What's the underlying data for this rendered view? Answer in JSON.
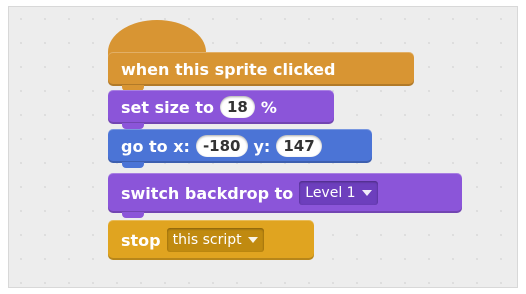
{
  "colors": {
    "events": "#d89533",
    "looks": "#8b55d9",
    "motion": "#4b74d6",
    "control": "#e0a420"
  },
  "script": {
    "hat": {
      "label": "when this sprite clicked"
    },
    "set_size": {
      "label": "set size to",
      "value": "18",
      "unit": "%"
    },
    "go_to": {
      "label": "go to x:",
      "x_value": "-180",
      "y_label": "y:",
      "y_value": "147"
    },
    "switch_backdrop": {
      "label": "switch backdrop to",
      "selected": "Level 1"
    },
    "stop": {
      "label": "stop",
      "selected": "this script"
    }
  },
  "icons": {
    "dropdown_arrow": "chevron-down-icon"
  }
}
